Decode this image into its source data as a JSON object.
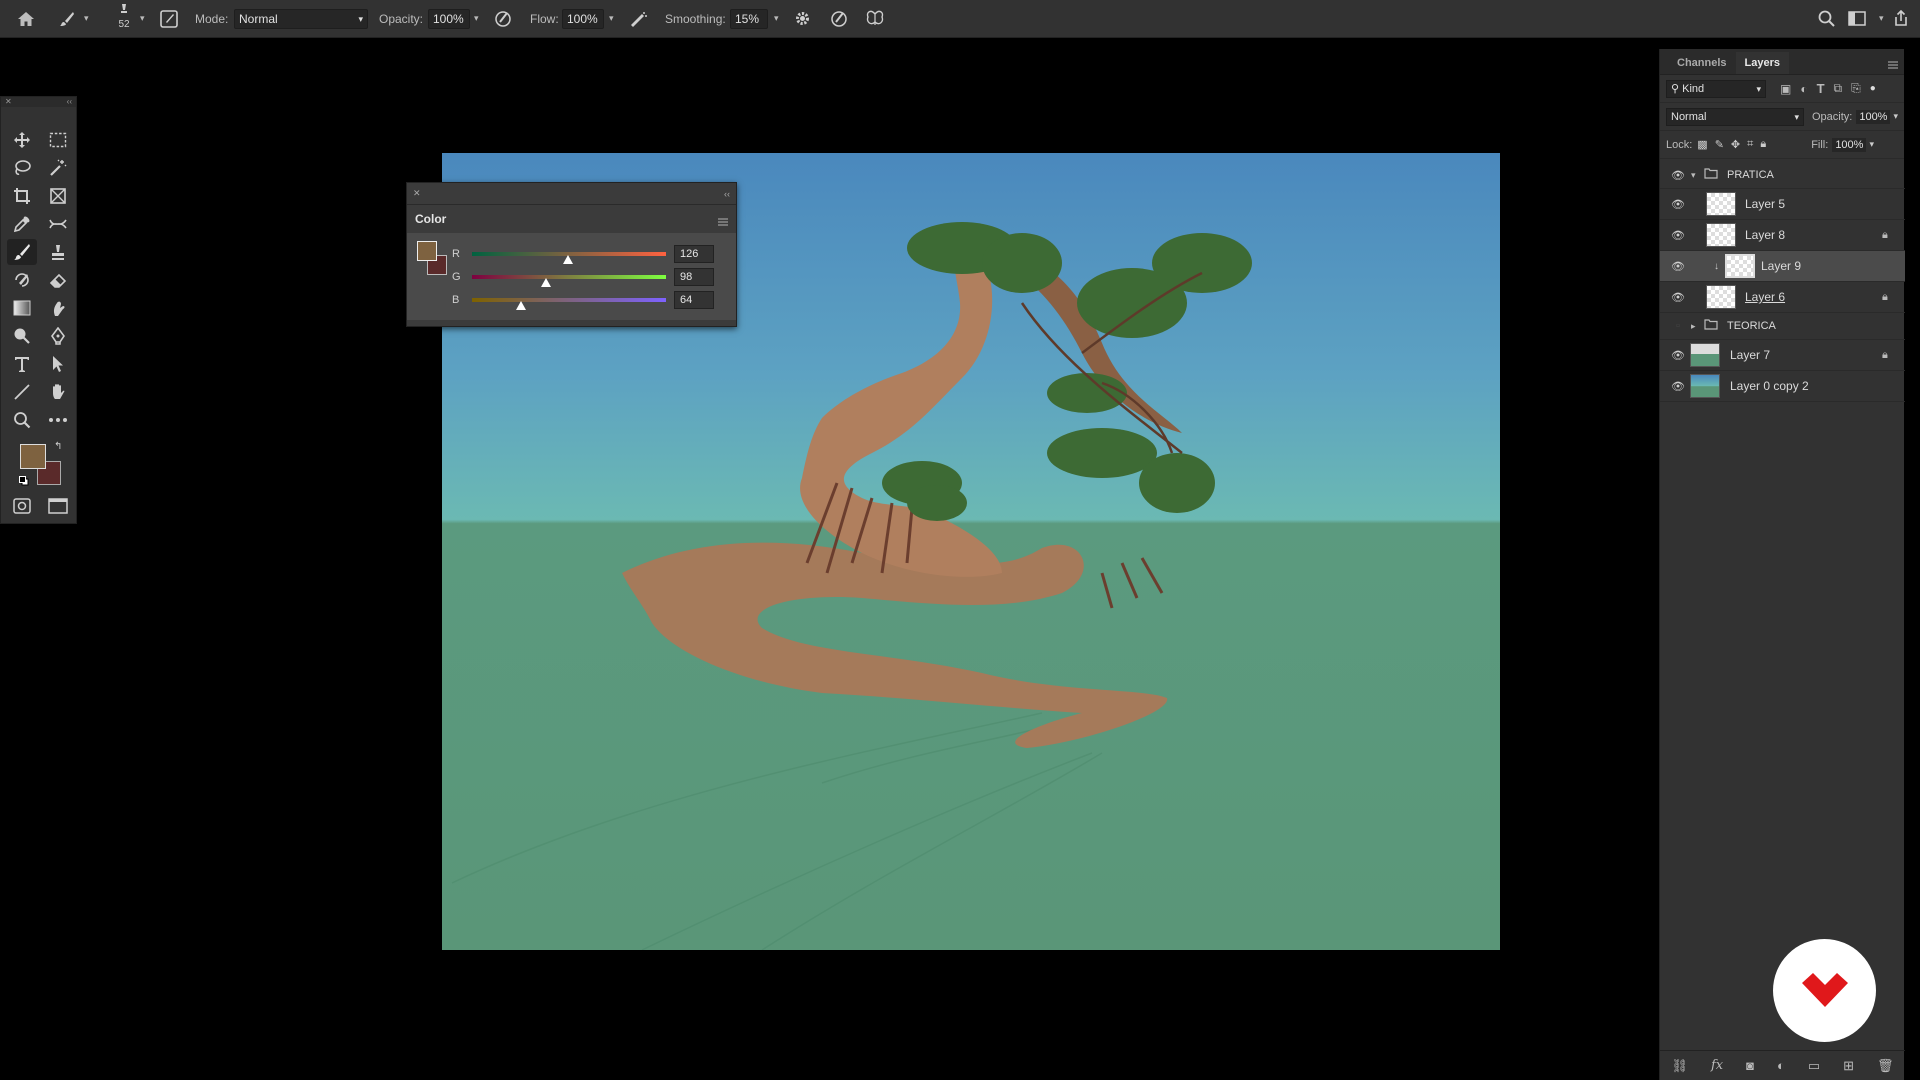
{
  "options_bar": {
    "brush_size": "52",
    "mode_label": "Mode:",
    "mode_value": "Normal",
    "opacity_label": "Opacity:",
    "opacity_value": "100%",
    "flow_label": "Flow:",
    "flow_value": "100%",
    "smoothing_label": "Smoothing:",
    "smoothing_value": "15%"
  },
  "color_panel": {
    "title": "Color",
    "foreground": "#7e6240",
    "background": "#5a2a2a",
    "channels": [
      {
        "label": "R",
        "value": "126",
        "fraction": 0.494,
        "gradient": "linear-gradient(90deg,#006240,#ff6240)"
      },
      {
        "label": "G",
        "value": "98",
        "fraction": 0.384,
        "gradient": "linear-gradient(90deg,#7e0040,#7eff40)"
      },
      {
        "label": "B",
        "value": "64",
        "fraction": 0.251,
        "gradient": "linear-gradient(90deg,#7e6200,#7e62ff)"
      }
    ]
  },
  "toolbox": {
    "foreground": "#7e6240",
    "background": "#5a2a2a"
  },
  "layers_panel": {
    "tab_channels": "Channels",
    "tab_layers": "Layers",
    "filter_kind": "Kind",
    "blend_mode": "Normal",
    "opacity_label": "Opacity:",
    "opacity_value": "100%",
    "lock_label": "Lock:",
    "fill_label": "Fill:",
    "fill_value": "100%",
    "layers": [
      {
        "name": "PRATICA",
        "type": "group",
        "expanded": true,
        "visible": true,
        "locked": false,
        "selected": false
      },
      {
        "name": "Layer 5",
        "type": "layer",
        "visible": true,
        "locked": false,
        "selected": false
      },
      {
        "name": "Layer 8",
        "type": "layer",
        "visible": true,
        "locked": true,
        "selected": false
      },
      {
        "name": "Layer 9",
        "type": "clipped",
        "visible": true,
        "locked": false,
        "selected": true
      },
      {
        "name": "Layer 6",
        "type": "layer",
        "visible": true,
        "locked": true,
        "selected": false
      },
      {
        "name": "TEORICA",
        "type": "group",
        "expanded": false,
        "visible": false,
        "locked": false,
        "selected": false
      },
      {
        "name": "Layer 7",
        "type": "layer",
        "visible": true,
        "locked": true,
        "selected": false
      },
      {
        "name": "Layer 0 copy 2",
        "type": "layer",
        "visible": true,
        "locked": false,
        "selected": false
      }
    ]
  },
  "colors": {
    "accent_logo": "#e0181b",
    "ui_background": "#323232"
  }
}
